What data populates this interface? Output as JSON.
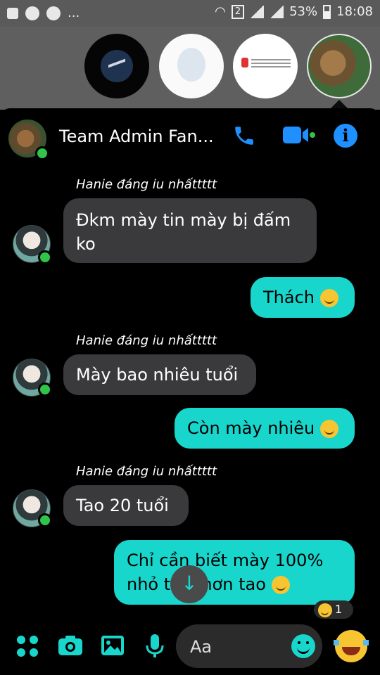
{
  "status_bar": {
    "sim_badge": "2",
    "battery": "53%",
    "time": "18:08",
    "dots": "..."
  },
  "chat_heads": [
    {
      "name": "messenger"
    },
    {
      "name": "contact-a"
    },
    {
      "name": "contact-b"
    },
    {
      "name": "group-cats"
    }
  ],
  "header": {
    "title": "Team Admin Fan...",
    "icons": [
      "phone-icon",
      "video-icon",
      "info-icon"
    ],
    "info_glyph": "i"
  },
  "messages": [
    {
      "direction": "in",
      "sender": "Hanie đáng iu nhấttttt",
      "text": "Đkm mày tin mày bị đấm ko"
    },
    {
      "direction": "out",
      "text": "Thách"
    },
    {
      "direction": "in",
      "sender": "Hanie đáng iu nhấttttt",
      "text": "Mày bao nhiêu tuổi"
    },
    {
      "direction": "out",
      "text": "Còn mày nhiêu"
    },
    {
      "direction": "in",
      "sender": "Hanie đáng iu nhấttttt",
      "text": "Tao 20 tuổi"
    },
    {
      "direction": "out",
      "text": "Chỉ cần biết mày 100% nhỏ tuổi hơn tao"
    }
  ],
  "reaction": {
    "count": "1"
  },
  "composer": {
    "placeholder": "Aa",
    "scroll_glyph": "↓"
  },
  "colors": {
    "accent": "#19d6cc",
    "incoming_bubble": "#3a3a3c",
    "background": "#000000",
    "online": "#31c44a"
  }
}
